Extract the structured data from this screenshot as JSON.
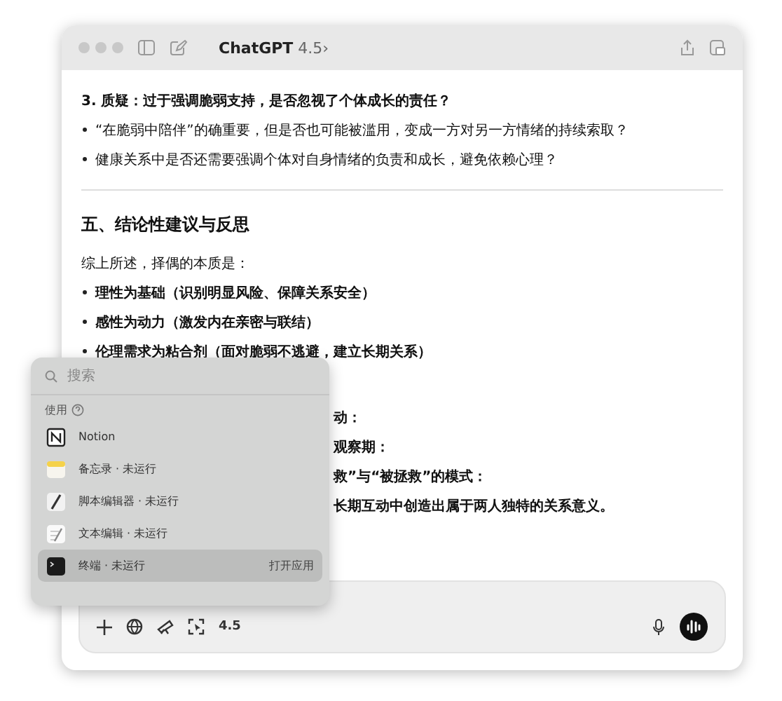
{
  "window": {
    "title": "ChatGPT",
    "model": "4.5",
    "chevron": "›"
  },
  "content": {
    "section_heading": "3. 质疑：过于强调脆弱支持，是否忽视了个体成长的责任？",
    "bullets": [
      "“在脆弱中陪伴”的确重要，但是否也可能被滥用，变成一方对另一方情绪的持续索取？",
      "健康关系中是否还需要强调个体对自身情绪的负责和成长，避免依赖心理？"
    ],
    "heading": "五、结论性建议与反思",
    "intro": "综上所述，择偶的本质是：",
    "points": [
      "理性为基础（识别明显风险、保障关系安全）",
      "感性为动力（激发内在亲密与联结）",
      "伦理需求为粘合剂（面对脆弱不逃避，建立长期关系）"
    ],
    "partial_lines": [
      "动：",
      "观察期：",
      "救”与“被拯救”的模式：",
      "长期互动中创造出属于两人独特的关系意义。"
    ]
  },
  "launcher": {
    "search": {
      "placeholder": "搜索"
    },
    "section": "使用",
    "items": [
      {
        "kind": "notion",
        "label": "Notion",
        "selected": false
      },
      {
        "kind": "notes",
        "label": "备忘录 · 未运行",
        "selected": false
      },
      {
        "kind": "script",
        "label": "脚本编辑器 · 未运行",
        "selected": false
      },
      {
        "kind": "textedit",
        "label": "文本编辑 · 未运行",
        "selected": false
      },
      {
        "kind": "terminal",
        "label": "终端 · 未运行",
        "selected": true,
        "action": "打开应用"
      }
    ]
  },
  "composer": {
    "model": "4.5"
  }
}
